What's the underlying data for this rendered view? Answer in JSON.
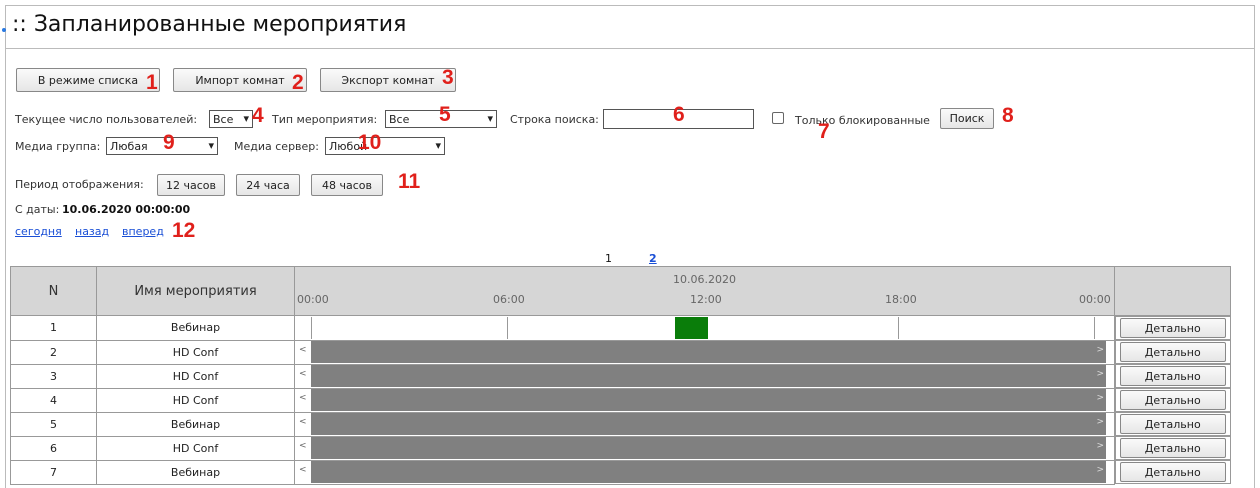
{
  "header": {
    "title": ":: Запланированные мероприятия"
  },
  "toolbar": {
    "list_mode": "В режиме списка",
    "import_rooms": "Импорт комнат",
    "export_rooms": "Экспорт комнат"
  },
  "filters": {
    "users_label": "Текущее число пользователей:",
    "users_value": "Все",
    "type_label": "Тип мероприятия:",
    "type_value": "Все",
    "search_label": "Строка поиска:",
    "search_value": "",
    "blocked_label": "Только блокированные",
    "search_button": "Поиск",
    "media_group_label": "Медиа группа:",
    "media_group_value": "Любая",
    "media_server_label": "Медиа сервер:",
    "media_server_value": "Любой"
  },
  "period": {
    "label": "Период отображения:",
    "options": [
      "12 часов",
      "24 часа",
      "48 часов"
    ]
  },
  "date": {
    "label": "С даты:",
    "value": "10.06.2020 00:00:00"
  },
  "nav": {
    "today": "сегодня",
    "back": "назад",
    "forward": "вперед"
  },
  "pagination": {
    "current": "1",
    "next": "2"
  },
  "markers": [
    "1",
    "2",
    "3",
    "4",
    "5",
    "6",
    "7",
    "8",
    "9",
    "10",
    "11",
    "12"
  ],
  "accent_colors": {
    "marker": "#e0201b",
    "event": "#0a7d0a",
    "link": "#1a4fd6"
  },
  "table": {
    "col_n": "N",
    "col_name": "Имя мероприятия",
    "timeline_date": "10.06.2020",
    "timeline_ticks": [
      "00:00",
      "06:00",
      "12:00",
      "18:00",
      "00:00"
    ],
    "detail_label": "Детально",
    "rows": [
      {
        "n": "1",
        "name": "Вебинар"
      },
      {
        "n": "2",
        "name": "HD Conf"
      },
      {
        "n": "3",
        "name": "HD Conf"
      },
      {
        "n": "4",
        "name": "HD Conf"
      },
      {
        "n": "5",
        "name": "Вебинар"
      },
      {
        "n": "6",
        "name": "HD Conf"
      },
      {
        "n": "7",
        "name": "Вебинар"
      }
    ]
  }
}
